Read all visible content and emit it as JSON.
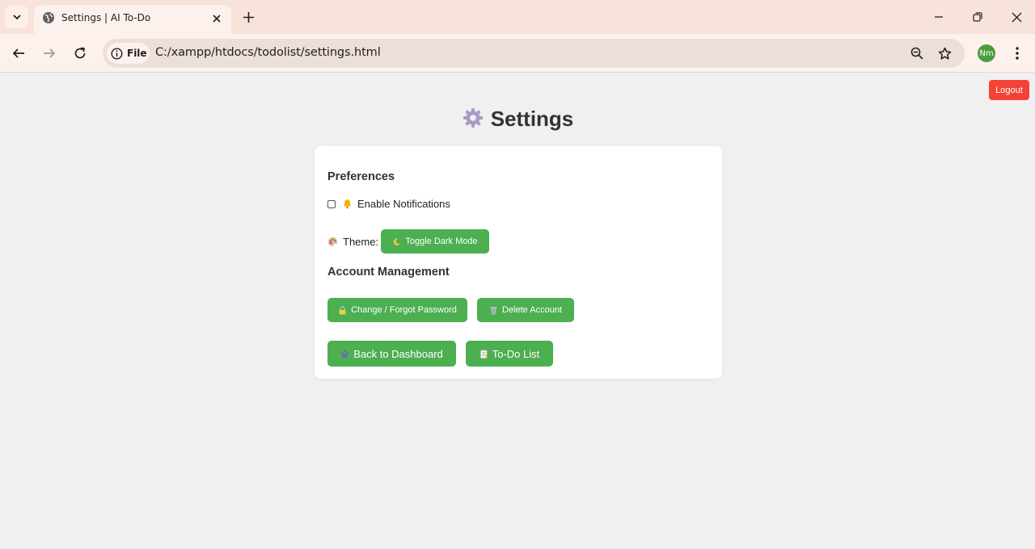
{
  "browser": {
    "tab_title": "Settings | AI To-Do",
    "chip_label": "File",
    "url": "C:/xampp/htdocs/todolist/settings.html",
    "profile_initials": "Nm"
  },
  "page": {
    "logout_label": "Logout",
    "title": "Settings",
    "preferences_heading": "Preferences",
    "notifications_label": "Enable Notifications",
    "notifications_checked": false,
    "theme_label": "Theme:",
    "toggle_dark_label": "Toggle Dark Mode",
    "account_heading": "Account Management",
    "change_password_label": "Change / Forgot Password",
    "delete_account_label": "Delete Account",
    "back_dashboard_label": "Back to Dashboard",
    "todo_list_label": "To-Do List"
  },
  "icons": {
    "title": "gear-icon",
    "notifications": "bell-icon",
    "theme": "palette-icon",
    "dark_mode": "moon-icon",
    "password": "lock-icon",
    "delete": "trash-icon",
    "dashboard": "home-icon",
    "todo": "memo-icon"
  },
  "colors": {
    "primary_button": "#4caf50",
    "logout_button": "#f44336",
    "page_background": "#f0f0f0",
    "tab_strip": "#f8e3da"
  }
}
